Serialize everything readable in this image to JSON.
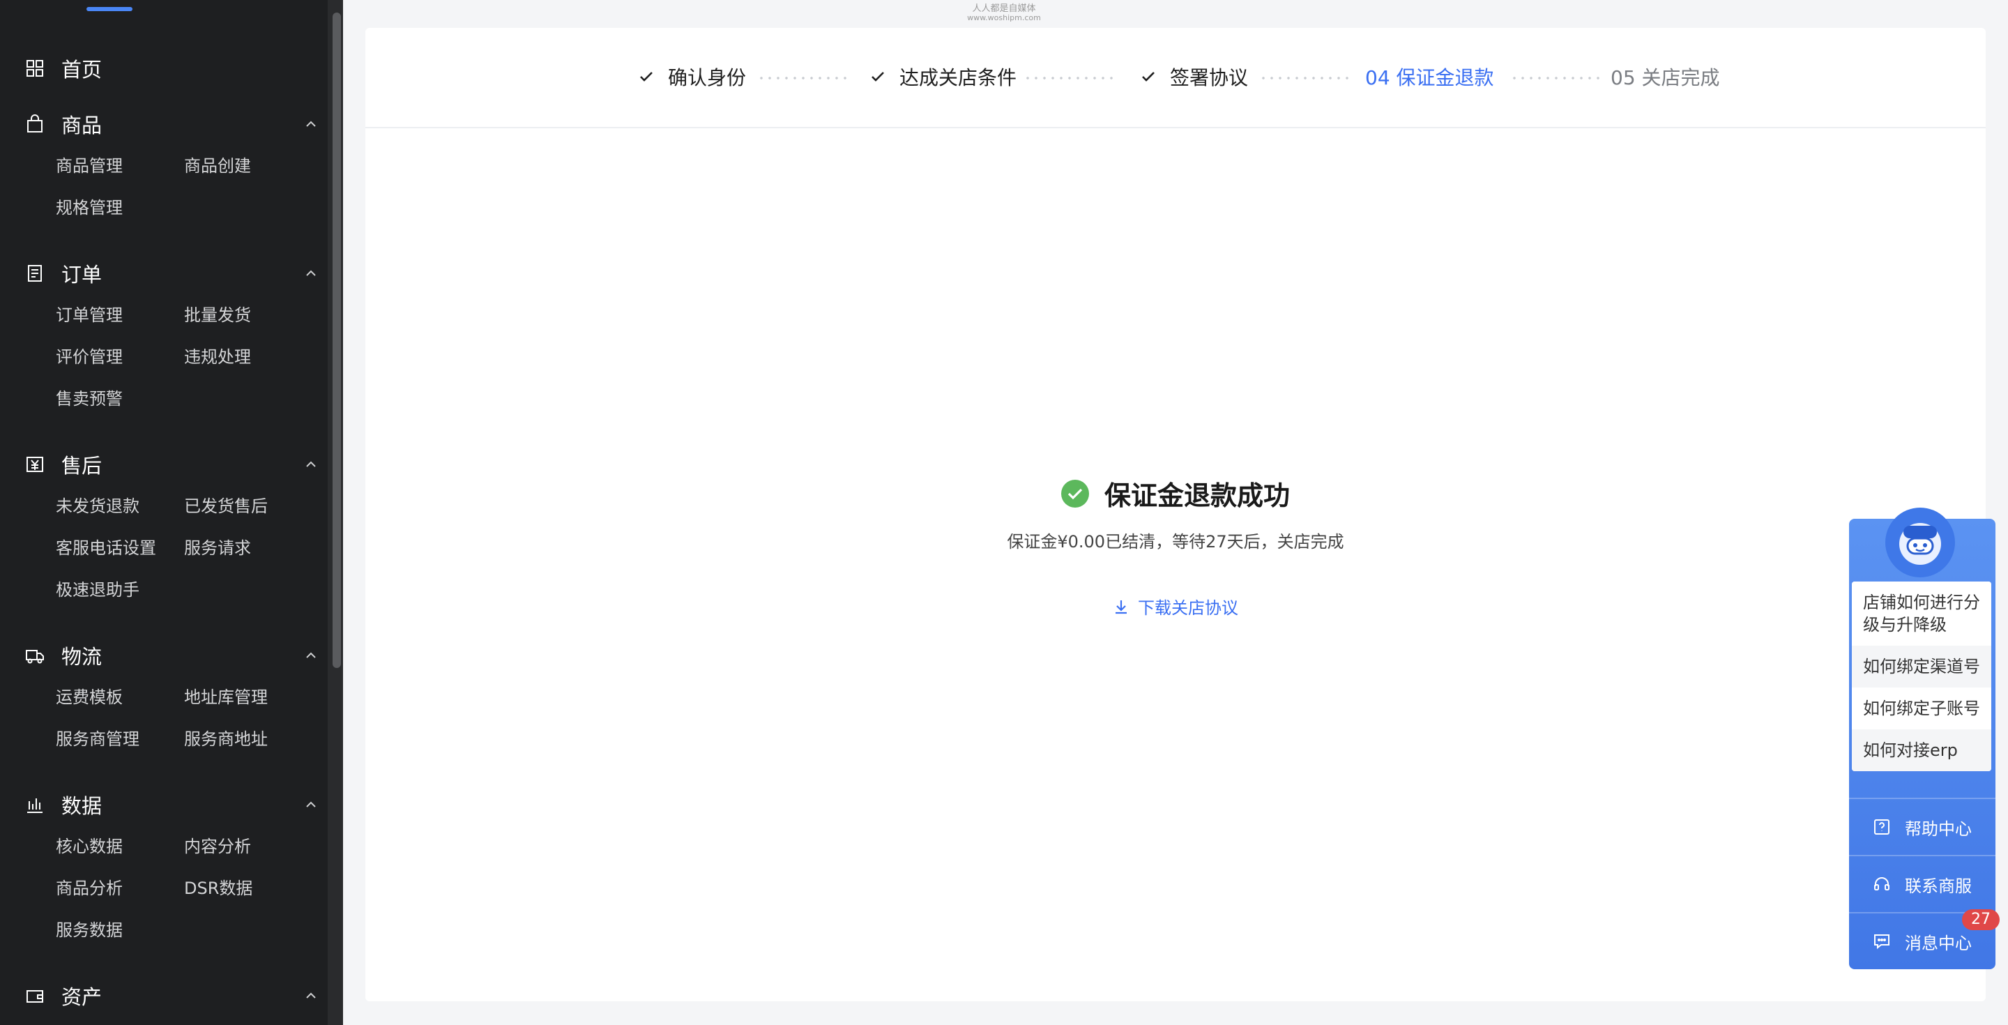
{
  "watermark": {
    "line1": "人人都是自媒体",
    "line2": "www.woshipm.com"
  },
  "sidebar": {
    "home": "首页",
    "sections": [
      {
        "title": "商品",
        "icon": "bag-icon",
        "items": [
          "商品管理",
          "商品创建",
          "规格管理"
        ]
      },
      {
        "title": "订单",
        "icon": "order-icon",
        "items": [
          "订单管理",
          "批量发货",
          "评价管理",
          "违规处理",
          "售卖预警"
        ]
      },
      {
        "title": "售后",
        "icon": "yen-icon",
        "items": [
          "未发货退款",
          "已发货售后",
          "客服电话设置",
          "服务请求",
          "极速退助手"
        ]
      },
      {
        "title": "物流",
        "icon": "truck-icon",
        "items": [
          "运费模板",
          "地址库管理",
          "服务商管理",
          "服务商地址"
        ]
      },
      {
        "title": "数据",
        "icon": "chart-icon",
        "items": [
          "核心数据",
          "内容分析",
          "商品分析",
          "DSR数据",
          "服务数据"
        ]
      },
      {
        "title": "资产",
        "icon": "wallet-icon",
        "items": []
      }
    ]
  },
  "steps": [
    {
      "label": "确认身份",
      "state": "done"
    },
    {
      "label": "达成关店条件",
      "state": "done"
    },
    {
      "label": "签署协议",
      "state": "done"
    },
    {
      "label": "04 保证金退款",
      "state": "active"
    },
    {
      "label": "05 关店完成",
      "state": "todo"
    }
  ],
  "result": {
    "title": "保证金退款成功",
    "desc": "保证金¥0.00已结清，等待27天后，关店完成",
    "link": "下载关店协议"
  },
  "help": {
    "faq": [
      "店铺如何进行分级与升降级",
      "如何绑定渠道号",
      "如何绑定子账号",
      "如何对接erp"
    ],
    "help_center": "帮助中心",
    "contact": "联系商服",
    "messages": "消息中心",
    "message_count": "27"
  },
  "colors": {
    "accent": "#3a6ff2",
    "success": "#5cb85c",
    "sidebar_bg": "#1e1f21",
    "badge": "#e04848"
  }
}
